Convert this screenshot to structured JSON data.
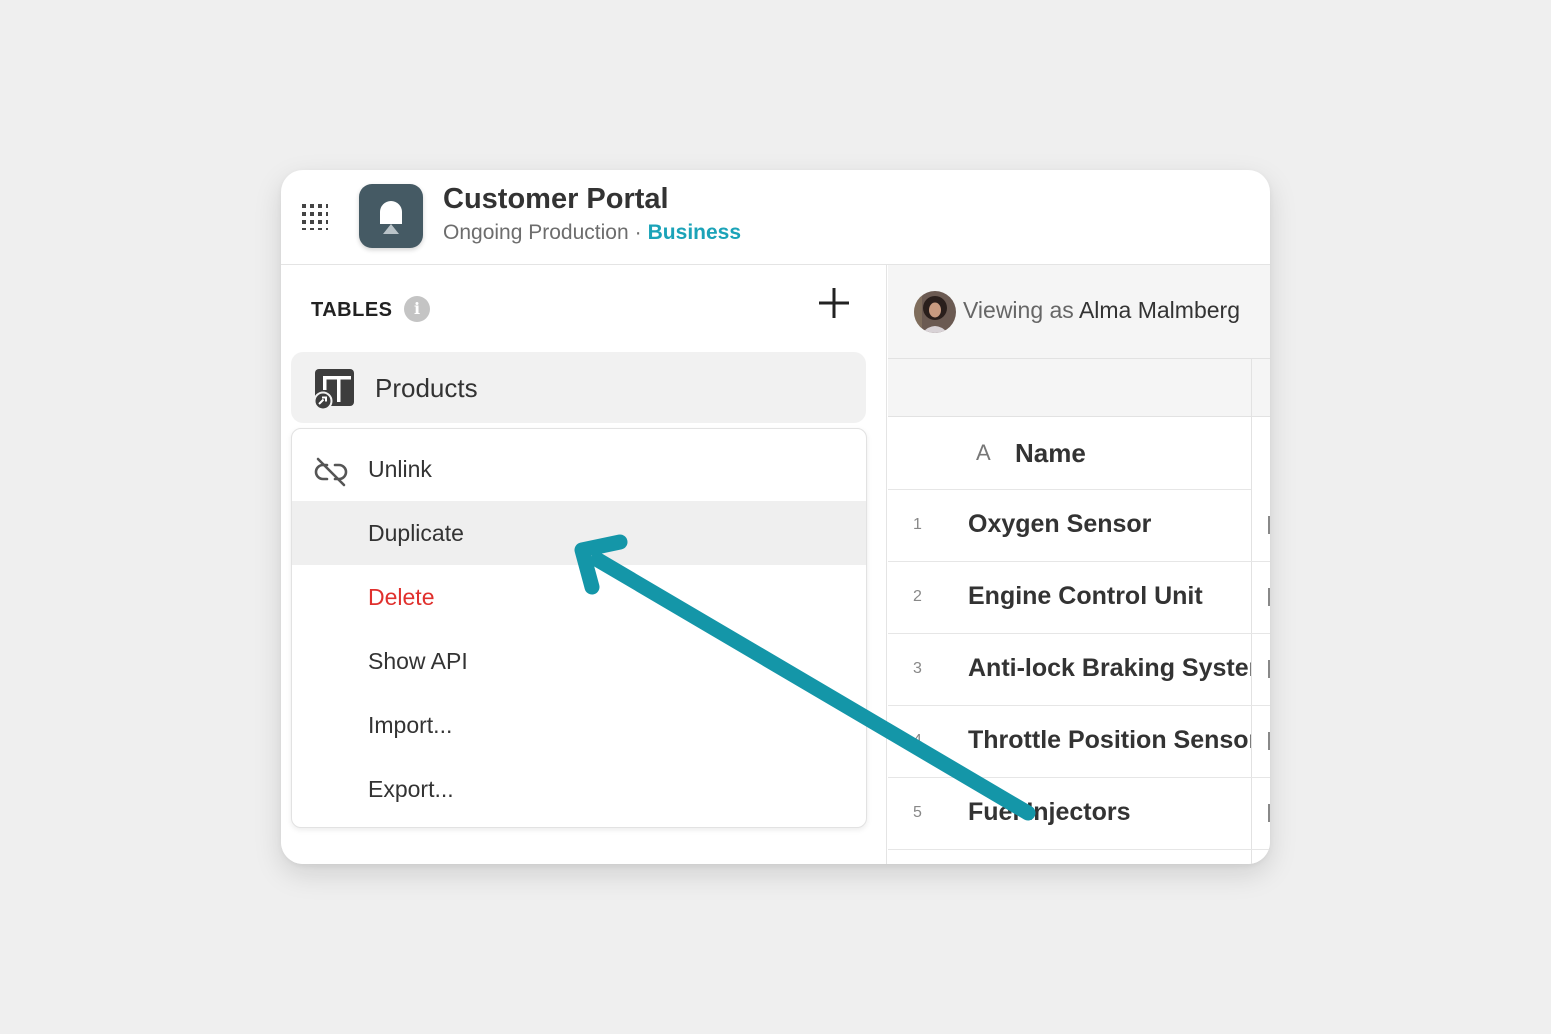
{
  "app": {
    "title": "Customer Portal",
    "subtitle": "Ongoing Production",
    "separator": "·",
    "plan": "Business"
  },
  "sidebar": {
    "section_label": "TABLES",
    "info_glyph": "i",
    "tables": [
      {
        "label": "Products",
        "icon": "table-link-icon"
      }
    ],
    "context_menu": [
      {
        "label": "Unlink",
        "icon": "unlink-icon"
      },
      {
        "label": "Duplicate",
        "state": "hover"
      },
      {
        "label": "Delete",
        "style": "danger"
      },
      {
        "label": "Show API"
      },
      {
        "label": "Import..."
      },
      {
        "label": "Export..."
      }
    ]
  },
  "main": {
    "viewing_prefix": "Viewing as",
    "viewing_user": "Alma Malmberg",
    "column": {
      "type_glyph": "A",
      "name": "Name"
    },
    "rows": [
      {
        "num": "1",
        "name": "Oxygen Sensor"
      },
      {
        "num": "2",
        "name": "Engine Control Unit"
      },
      {
        "num": "3",
        "name": "Anti-lock Braking System"
      },
      {
        "num": "4",
        "name": "Throttle Position Sensor"
      },
      {
        "num": "5",
        "name": "Fuel Injectors"
      }
    ]
  },
  "colors": {
    "accent": "#1ba3b8",
    "arrow": "#1496a8",
    "danger": "#e0302d",
    "logo_bg": "#455a64"
  }
}
